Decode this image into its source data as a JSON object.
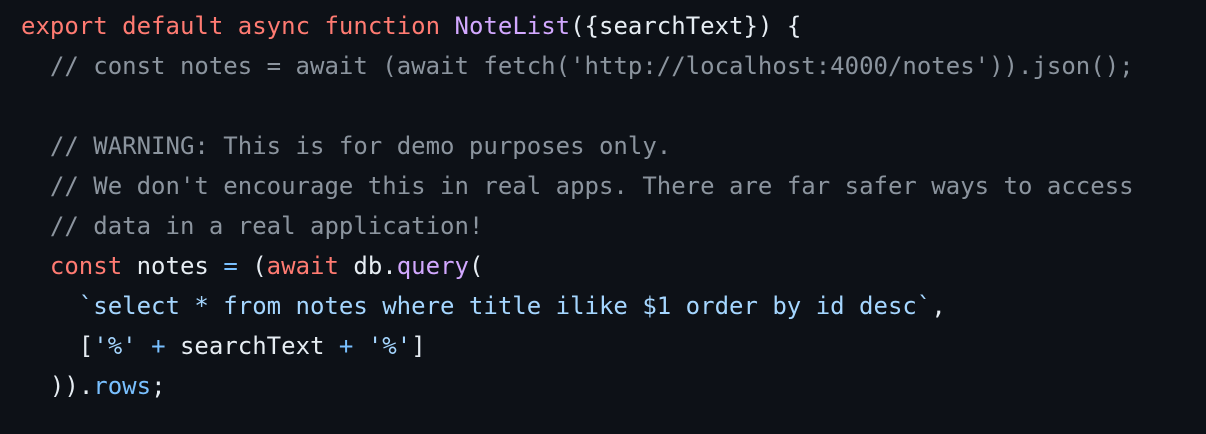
{
  "code": {
    "line1": {
      "kw_export": "export",
      "kw_default": "default",
      "kw_async": "async",
      "kw_function": "function",
      "fn_name": "NoteList",
      "params": "({searchText})",
      "brace": "{"
    },
    "line2": {
      "comment": "// const notes = await (await fetch('http://localhost:4000/notes')).json();"
    },
    "line3": {
      "comment": "// WARNING: This is for demo purposes only."
    },
    "line4": {
      "comment": "// We don't encourage this in real apps. There are far safer ways to access"
    },
    "line5": {
      "comment": "// data in a real application!"
    },
    "line6": {
      "kw_const": "const",
      "var": "notes",
      "eq": "=",
      "paren": "(",
      "kw_await": "await",
      "obj": "db",
      "dot": ".",
      "method": "query",
      "open": "("
    },
    "line7": {
      "template": "`select * from notes where title ilike $1 order by id desc`",
      "comma": ","
    },
    "line8": {
      "open": "[",
      "str1": "'%'",
      "plus1": "+",
      "var": "searchText",
      "plus2": "+",
      "str2": "'%'",
      "close": "]"
    },
    "line9": {
      "close": "))",
      "dot": ".",
      "prop": "rows",
      "semi": ";"
    }
  }
}
